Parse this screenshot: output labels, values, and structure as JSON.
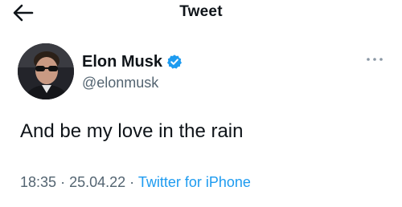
{
  "header": {
    "title": "Tweet",
    "back_icon": "arrow-left-icon"
  },
  "tweet": {
    "author": {
      "name": "Elon Musk",
      "handle": "@elonmusk",
      "verified": true,
      "verified_icon": "verified-badge-icon"
    },
    "more_icon": "more-horizontal-icon",
    "text": "And be my love in the rain",
    "time": "18:35",
    "date": "25.04.22",
    "separator": "·",
    "source": "Twitter for iPhone"
  },
  "colors": {
    "text_primary": "#0f1419",
    "text_secondary": "#536471",
    "accent": "#1d9bf0",
    "background": "#ffffff"
  }
}
